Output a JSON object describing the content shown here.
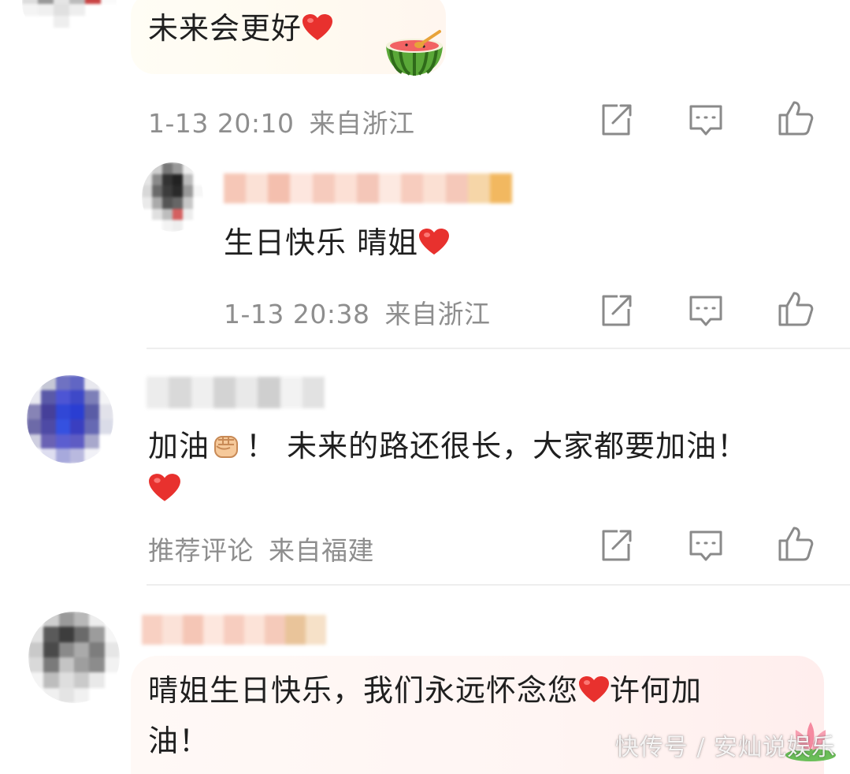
{
  "comments": [
    {
      "content": "未来会更好",
      "time": "1-13 20:10",
      "location": "来自浙江"
    },
    {
      "content": "生日快乐 晴姐",
      "time": "1-13 20:38",
      "location": "来自浙江"
    },
    {
      "content_part1": "加油",
      "content_part2": "！ 未来的路还很长，大家都要加油！",
      "tag": "推荐评论",
      "location": "来自福建"
    },
    {
      "content_line1": "晴姐生日快乐，我们永远怀念您",
      "content_line1_tail": "许何加",
      "content_line2": "油！"
    }
  ],
  "icons": {
    "repost": "share-icon",
    "comment": "comment-icon",
    "like": "like-icon",
    "heart": "heart-icon",
    "fist": "fist-emoji-icon",
    "watermelon": "watermelon-sticker-icon",
    "lotus": "lotus-icon"
  },
  "watermark": "快传号 / 安灿说娱乐",
  "colors": {
    "meta_text": "#8e8e8e",
    "heart": "#e8312e",
    "divider": "#eeeeee"
  }
}
